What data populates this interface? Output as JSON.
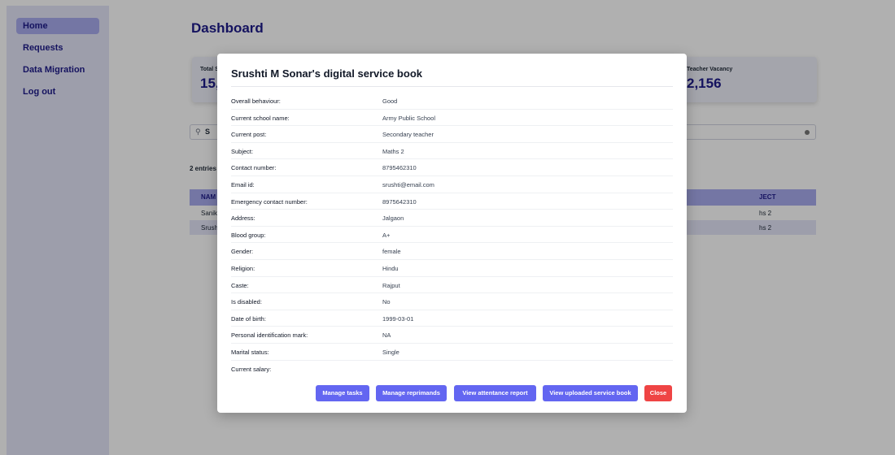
{
  "sidebar": {
    "items": [
      {
        "label": "Home"
      },
      {
        "label": "Requests"
      },
      {
        "label": "Data Migration"
      },
      {
        "label": "Log out"
      }
    ]
  },
  "page": {
    "title": "Dashboard",
    "stats": [
      {
        "label": "Total S",
        "value": "15,"
      },
      {
        "label": "Teacher Vacancy",
        "value": "2,156"
      }
    ],
    "search": {
      "value": "S"
    },
    "entries_text": "2 entries",
    "table": {
      "headers": [
        "NAM",
        "JECT"
      ],
      "rows": [
        [
          "Sanik",
          "hs 2"
        ],
        [
          "Srush",
          "hs 2"
        ]
      ]
    }
  },
  "modal": {
    "title": "Srushti M Sonar's digital service book",
    "details": [
      {
        "label": "Overall behaviour:",
        "value": "Good"
      },
      {
        "label": "Current school name:",
        "value": "Army Public School"
      },
      {
        "label": "Current post:",
        "value": "Secondary teacher"
      },
      {
        "label": "Subject:",
        "value": "Maths 2"
      },
      {
        "label": "Contact number:",
        "value": "8795462310"
      },
      {
        "label": "Email id:",
        "value": "srushti@email.com"
      },
      {
        "label": "Emergency contact number:",
        "value": "8975642310"
      },
      {
        "label": "Address:",
        "value": "Jalgaon"
      },
      {
        "label": "Blood group:",
        "value": "A+"
      },
      {
        "label": "Gender:",
        "value": "female"
      },
      {
        "label": "Religion:",
        "value": "Hindu"
      },
      {
        "label": "Caste:",
        "value": "Rajput"
      },
      {
        "label": "Is disabled:",
        "value": "No"
      },
      {
        "label": "Date of birth:",
        "value": "1999-03-01"
      },
      {
        "label": "Personal identification mark:",
        "value": "NA"
      },
      {
        "label": "Marital status:",
        "value": "Single"
      },
      {
        "label": "Current salary:",
        "value": ""
      }
    ],
    "buttons": {
      "manage_tasks": "Manage tasks",
      "manage_reprimands": "Manage reprimands",
      "view_attendance": "View attentance report",
      "view_service_book": "View uploaded service book",
      "close": "Close"
    }
  },
  "colors": {
    "primary": "#6366f1",
    "danger": "#ef4444",
    "nav_text": "#1e1b8a",
    "sidebar_bg": "#e4e5f8",
    "active_bg": "#a9abee"
  }
}
